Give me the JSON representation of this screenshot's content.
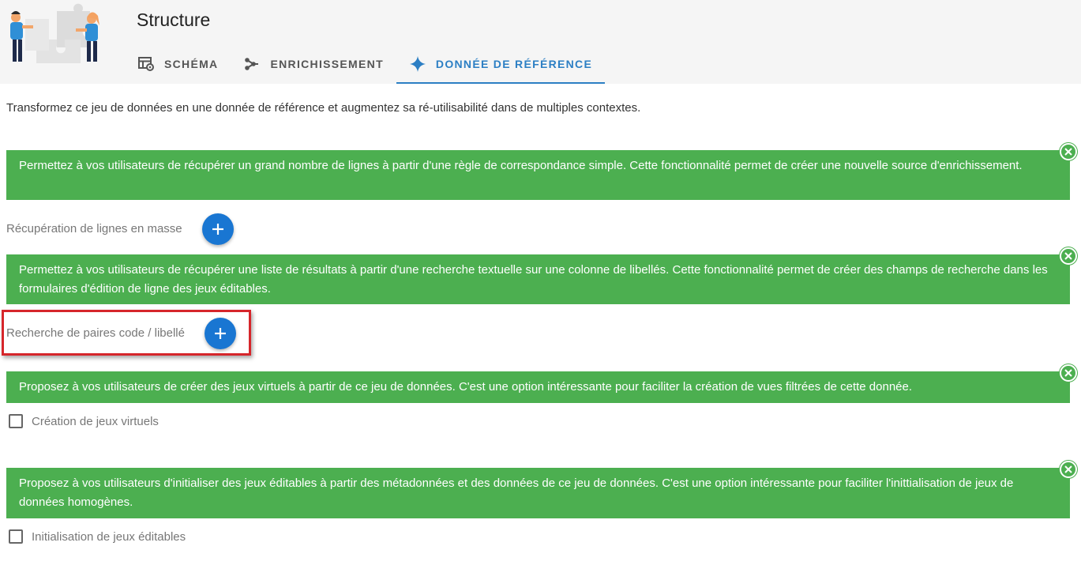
{
  "header": {
    "title": "Structure",
    "tabs": [
      {
        "label": "SCHÉMA",
        "icon": "table-settings-icon"
      },
      {
        "label": "ENRICHISSEMENT",
        "icon": "graph-nodes-icon"
      },
      {
        "label": "DONNÉE DE RÉFÉRENCE",
        "icon": "sparkle-icon",
        "active": true
      }
    ]
  },
  "intro": "Transformez ce jeu de données en une donnée de référence et augmentez sa ré-utilisabilité dans de multiples contextes.",
  "sections": {
    "bulk": {
      "banner": "Permettez à vos utilisateurs de récupérer un grand nombre de lignes à partir d'une règle de correspondance simple. Cette fonctionnalité permet de créer une nouvelle source d'enrichissement.",
      "label": "Récupération de lignes en masse"
    },
    "pairs": {
      "banner": "Permettez à vos utilisateurs de récupérer une liste de résultats à partir d'une recherche textuelle sur une colonne de libellés. Cette fonctionnalité permet de créer des champs de recherche dans les formulaires d'édition de ligne des jeux éditables.",
      "label": "Recherche de paires code / libellé"
    },
    "virtual": {
      "banner": "Proposez à vos utilisateurs de créer des jeux virtuels à partir de ce jeu de données. C'est une option intéressante pour faciliter la création de vues filtrées de cette donnée.",
      "label": "Création de jeux virtuels",
      "checked": false
    },
    "editable": {
      "banner": "Proposez à vos utilisateurs d'initialiser des jeux éditables à partir des métadonnées et des données de ce jeu de données. C'est une option intéressante pour faciliter l'inittialisation de jeux de données homogènes.",
      "label": "Initialisation de jeux éditables",
      "checked": false
    }
  },
  "colors": {
    "banner": "#4caf50",
    "accent": "#2c7fc4",
    "add_button": "#1976d2",
    "highlight": "#d6262b"
  }
}
